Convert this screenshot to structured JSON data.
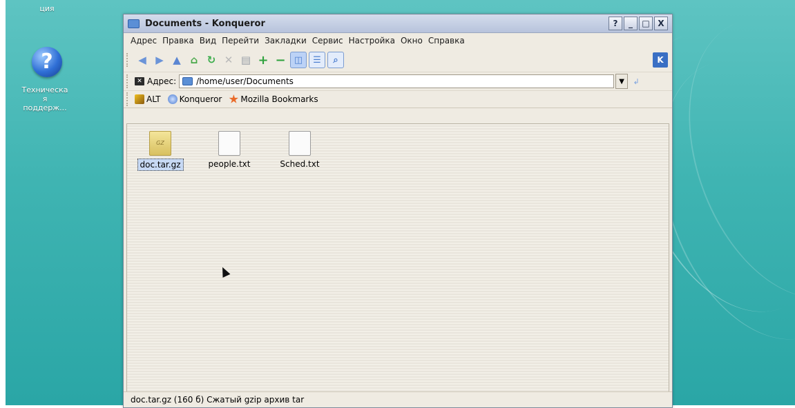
{
  "desktop": {
    "top_partial_label": "ция",
    "help_icon_label_lines": [
      "Техническа",
      "я",
      "поддерж..."
    ]
  },
  "window": {
    "title": "Documents - Konqueror",
    "buttons": {
      "help": "?",
      "minimize": "_",
      "maximize": "□",
      "close": "X"
    },
    "menu": [
      "Адрес",
      "Правка",
      "Вид",
      "Перейти",
      "Закладки",
      "Сервис",
      "Настройка",
      "Окно",
      "Справка"
    ],
    "location_label": "Адрес:",
    "location_value": "/home/user/Documents",
    "bookmarks": [
      "ALT",
      "Konqueror",
      "Mozilla Bookmarks"
    ],
    "files": [
      {
        "name": "doc.tar.gz",
        "icon_text": "GZ",
        "selected": true
      },
      {
        "name": "people.txt",
        "icon_text": "",
        "selected": false
      },
      {
        "name": "Sched.txt",
        "icon_text": "",
        "selected": false
      }
    ],
    "status": "doc.tar.gz (160 б) Сжатый gzip архив tar"
  }
}
